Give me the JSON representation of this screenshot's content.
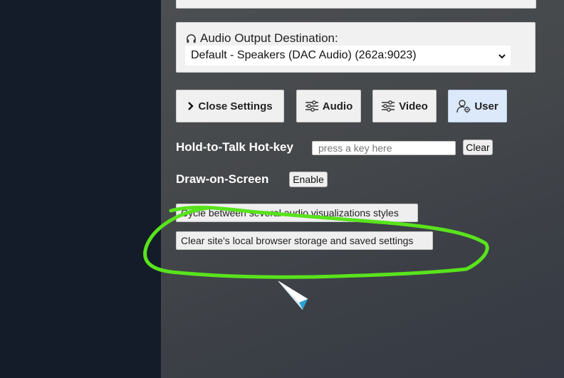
{
  "audio": {
    "label": "Audio Output Destination:",
    "selected": "Default - Speakers (DAC Audio) (262a:9023)"
  },
  "settings_buttons": {
    "close": "Close Settings",
    "audio": "Audio",
    "video": "Video",
    "user": "User"
  },
  "hotkey": {
    "label": "Hold-to-Talk Hot-key",
    "placeholder": "press a key here",
    "clear": "Clear"
  },
  "draw": {
    "label": "Draw-on-Screen",
    "enable": "Enable"
  },
  "actions": {
    "cycle": "Cycle between several audio visualizations styles",
    "clear_storage": "Clear site's local browser storage and saved settings"
  },
  "colors": {
    "annotation": "#59e31d",
    "user_active_bg": "#dbe9fb",
    "left_panel": "#141b29"
  },
  "icons": {
    "audio_label": "headphones-icon",
    "close": "chevron-right-icon",
    "audio": "sliders-icon",
    "video": "sliders-icon",
    "user": "user-gear-icon",
    "select": "chevron-down-icon"
  }
}
